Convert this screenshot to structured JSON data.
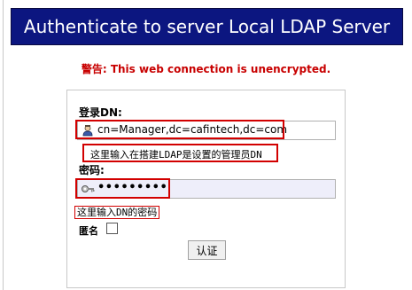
{
  "header": {
    "title": "Authenticate to server Local LDAP Server"
  },
  "warning": "警告: This web connection is unencrypted.",
  "form": {
    "dn_label": "登录DN:",
    "dn_value": "cn=Manager,dc=cafintech,dc=com",
    "dn_hint": "这里输入在搭建LDAP是设置的管理员DN",
    "password_label": "密码:",
    "password_value": "•••••••••",
    "password_hint": "这里输入DN的密码",
    "anonymous_label": "匿名",
    "anonymous_checked": false,
    "submit_label": "认证"
  },
  "icons": {
    "dn": "user-icon",
    "password": "key-icon"
  },
  "colors": {
    "header_bg": "#0c1680",
    "warning": "#c80000",
    "annotation": "#d20000"
  }
}
